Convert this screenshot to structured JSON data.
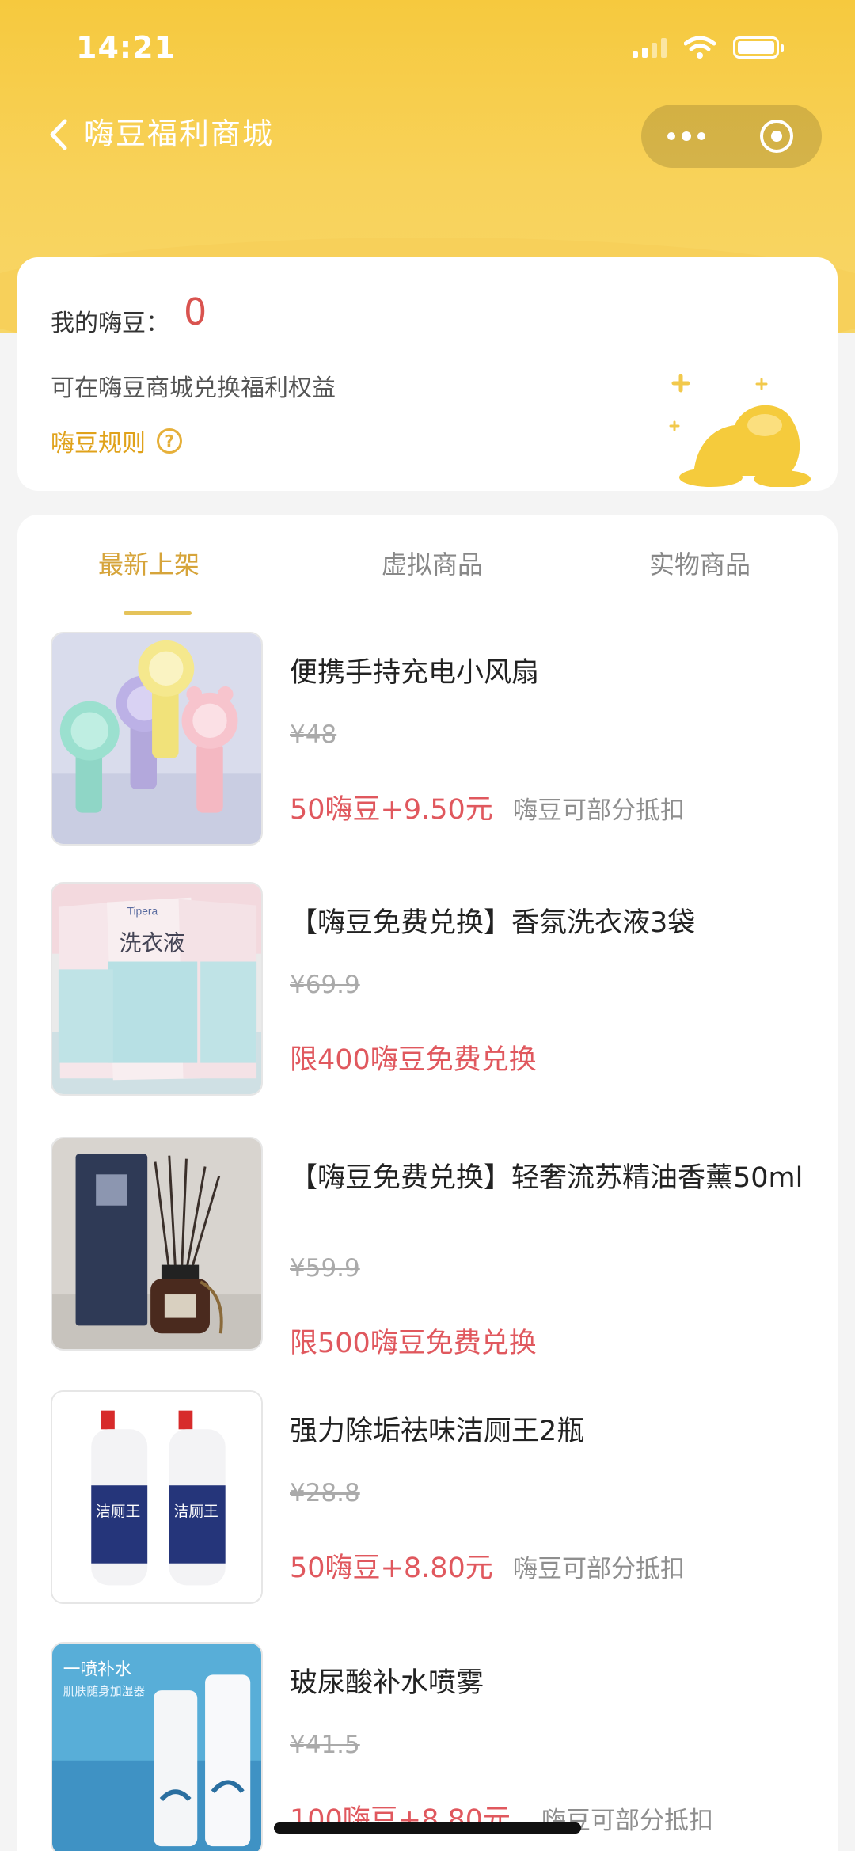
{
  "status_bar": {
    "time": "14:21"
  },
  "nav": {
    "title": "嗨豆福利商城"
  },
  "bean_card": {
    "label": "我的嗨豆：",
    "value": "0",
    "description": "可在嗨豆商城兑换福利权益",
    "rules_link": "嗨豆规则",
    "help_icon_glyph": "?"
  },
  "tabs": [
    {
      "label": "最新上架"
    },
    {
      "label": "虚拟商品"
    },
    {
      "label": "实物商品"
    }
  ],
  "products": [
    {
      "name": "便携手持充电小风扇",
      "original_price": "¥48",
      "price": "50嗨豆+9.50元",
      "note": "嗨豆可部分抵扣"
    },
    {
      "name": "【嗨豆免费兑换】香氛洗衣液3袋",
      "original_price": "¥69.9",
      "price": "限400嗨豆免费兑换",
      "note": ""
    },
    {
      "name": "【嗨豆免费兑换】轻奢流苏精油香薰50ml",
      "original_price": "¥59.9",
      "price": "限500嗨豆免费兑换",
      "note": ""
    },
    {
      "name": "强力除垢祛味洁厕王2瓶",
      "original_price": "¥28.8",
      "price": "50嗨豆+8.80元",
      "note": "嗨豆可部分抵扣"
    },
    {
      "name": "玻尿酸补水喷雾",
      "original_price": "¥41.5",
      "price": "100嗨豆+8.80元",
      "note": "嗨豆可部分抵扣"
    }
  ],
  "product_images": {
    "laundry_brand": "Tipera",
    "laundry_text": "洗衣液",
    "cleaner_text": "洁厕王",
    "spray_title": "一喷补水",
    "spray_subtitle": "肌肤随身加湿器"
  },
  "colors": {
    "brand_yellow": "#f6c93e",
    "price_red": "#e0585e",
    "active_tab": "#d6a43a"
  }
}
